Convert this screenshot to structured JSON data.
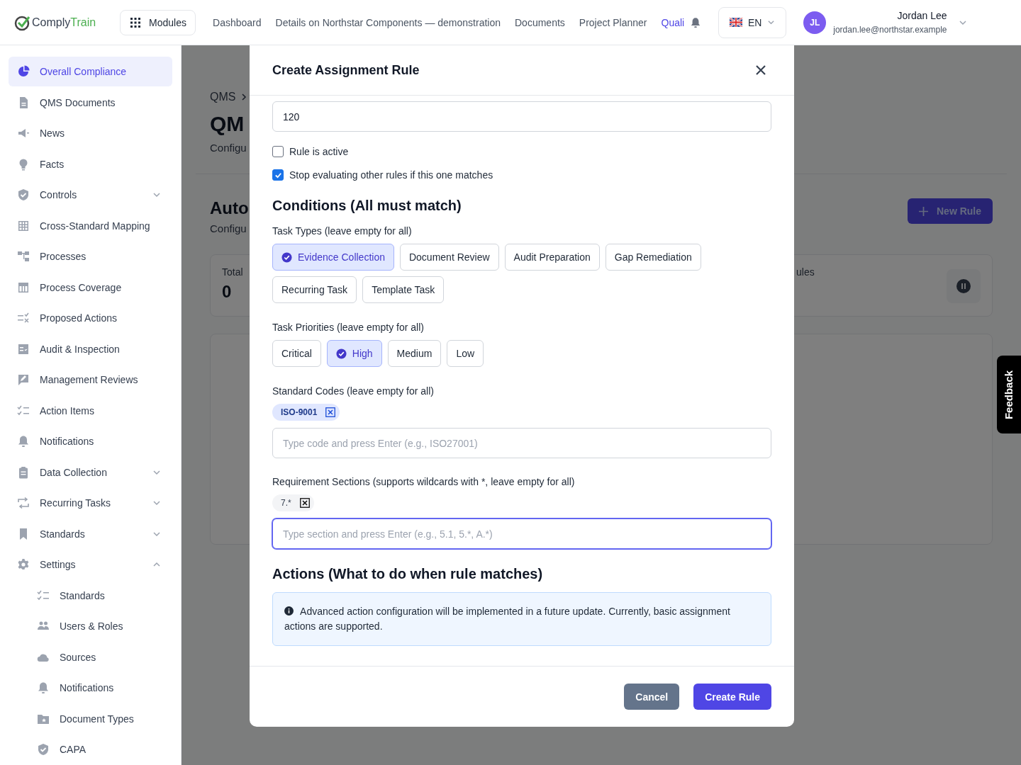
{
  "header": {
    "logo": {
      "brand": "Comply",
      "accent": "Train"
    },
    "modules_button": "Modules",
    "nav": [
      {
        "label": "Dashboard",
        "selected": false
      },
      {
        "label": "Details on Northstar Components — demonstration",
        "selected": false
      },
      {
        "label": "Documents",
        "selected": false
      },
      {
        "label": "Project Planner",
        "selected": false
      },
      {
        "label": "Quali",
        "selected": true
      }
    ],
    "language": "EN",
    "user": {
      "initials": "JL",
      "name": "Jordan Lee",
      "email": "jordan.lee@northstar.example"
    }
  },
  "sidebar": {
    "items": [
      {
        "label": "Overall Compliance",
        "selected": true
      },
      {
        "label": "QMS Documents",
        "selected": false
      },
      {
        "label": "News",
        "selected": false
      },
      {
        "label": "Facts",
        "selected": false
      },
      {
        "label": "Controls",
        "selected": false,
        "expanded": false
      },
      {
        "label": "Cross-Standard Mapping",
        "selected": false
      },
      {
        "label": "Processes",
        "selected": false
      },
      {
        "label": "Process Coverage",
        "selected": false
      },
      {
        "label": "Proposed Actions",
        "selected": false
      },
      {
        "label": "Audit & Inspection",
        "selected": false
      },
      {
        "label": "Management Reviews",
        "selected": false
      },
      {
        "label": "Action Items",
        "selected": false
      },
      {
        "label": "Notifications",
        "selected": false
      },
      {
        "label": "Data Collection",
        "selected": false,
        "expanded": false
      },
      {
        "label": "Recurring Tasks",
        "selected": false,
        "expanded": false
      },
      {
        "label": "Standards",
        "selected": false,
        "expanded": false
      },
      {
        "label": "Settings",
        "selected": false,
        "expanded": true,
        "children": [
          {
            "label": "Standards",
            "selected": false
          },
          {
            "label": "Users & Roles",
            "selected": false
          },
          {
            "label": "Sources",
            "selected": false
          },
          {
            "label": "Notifications",
            "selected": false
          },
          {
            "label": "Document Types",
            "selected": false
          },
          {
            "label": "CAPA",
            "selected": false
          }
        ]
      }
    ]
  },
  "page": {
    "breadcrumb": "QMS",
    "title": "QM",
    "subtitle": "Configu",
    "section_title": "Auto",
    "section_subtitle": "Configu",
    "new_rule_button": "New Rule",
    "stats": [
      {
        "label": "Total",
        "value": "0"
      },
      {
        "label": "ules"
      }
    ]
  },
  "feedback_tab": "Feedback",
  "dialog": {
    "title": "Create Assignment Rule",
    "value_field": "120",
    "checkboxes": [
      {
        "label": "Rule is active",
        "checked": false
      },
      {
        "label": "Stop evaluating other rules if this one matches",
        "checked": true
      }
    ],
    "conditions_heading": "Conditions (All must match)",
    "task_types": {
      "label": "Task Types (leave empty for all)",
      "options": [
        {
          "label": "Evidence Collection",
          "selected": true
        },
        {
          "label": "Document Review",
          "selected": false
        },
        {
          "label": "Audit Preparation",
          "selected": false
        },
        {
          "label": "Gap Remediation",
          "selected": false
        },
        {
          "label": "Recurring Task",
          "selected": false
        },
        {
          "label": "Template Task",
          "selected": false
        }
      ]
    },
    "task_priorities": {
      "label": "Task Priorities (leave empty for all)",
      "options": [
        {
          "label": "Critical",
          "selected": false
        },
        {
          "label": "High",
          "selected": true
        },
        {
          "label": "Medium",
          "selected": false
        },
        {
          "label": "Low",
          "selected": false
        }
      ]
    },
    "standard_codes": {
      "label": "Standard Codes (leave empty for all)",
      "kind": "code",
      "tags": [
        "ISO-9001"
      ],
      "placeholder": "Type code and press Enter (e.g., ISO27001)",
      "focused": false
    },
    "requirement_sections": {
      "label": "Requirement Sections (supports wildcards with *, leave empty for all)",
      "kind": "section",
      "tags": [
        "7.*"
      ],
      "placeholder": "Type section and press Enter (e.g., 5.1, 5.*, A.*)",
      "focused": true
    },
    "actions_heading": "Actions (What to do when rule matches)",
    "info": "Advanced action configuration will be implemented in a future update. Currently, basic assignment actions are supported.",
    "buttons": [
      {
        "label": "Cancel",
        "kind": "secondary"
      },
      {
        "label": "Create Rule",
        "kind": "primary"
      }
    ]
  }
}
